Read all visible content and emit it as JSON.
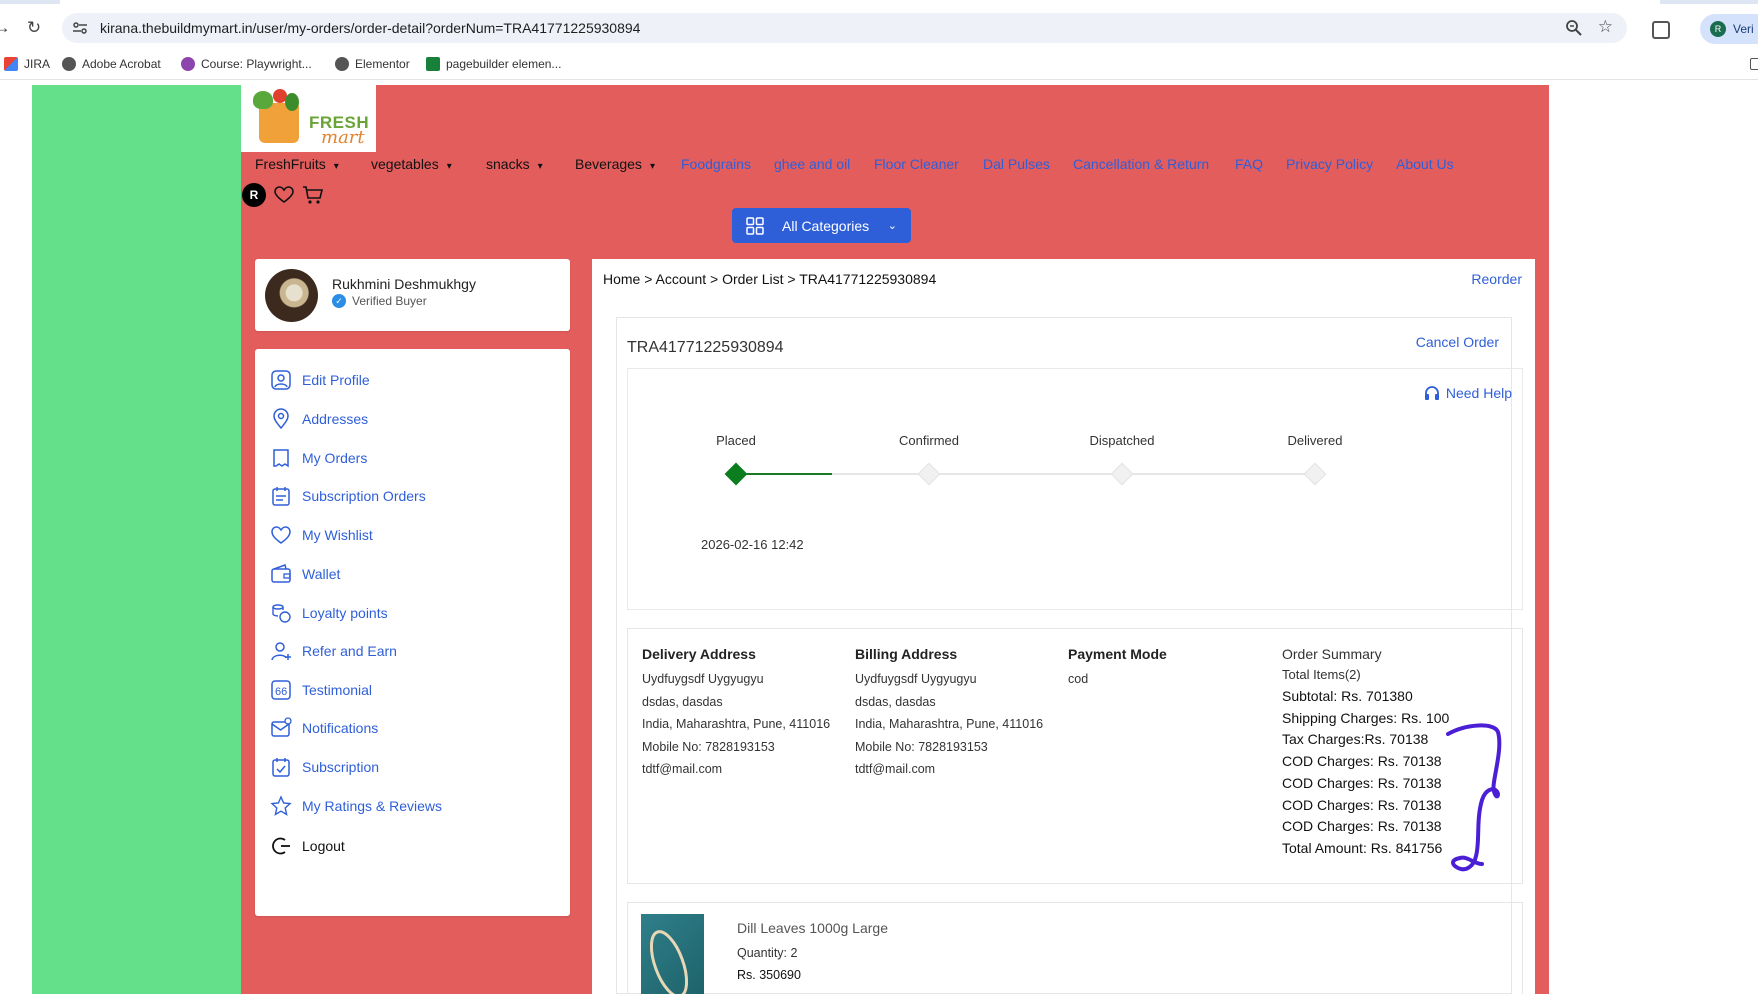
{
  "browser": {
    "url": "kirana.thebuildmymart.in/user/my-orders/order-detail?orderNum=TRA41771225930894",
    "profile_label": "Veri",
    "profile_initial": "R"
  },
  "bookmarks": [
    {
      "label": "JIRA",
      "icon": "gmail-icon",
      "color": "#d93025"
    },
    {
      "label": "Adobe Acrobat",
      "icon": "globe-icon",
      "color": "#555555"
    },
    {
      "label": "Course: Playwright...",
      "icon": "course-icon",
      "color": "#8e44ad"
    },
    {
      "label": "Elementor",
      "icon": "globe-icon",
      "color": "#555555"
    },
    {
      "label": "pagebuilder elemen...",
      "icon": "sheets-icon",
      "color": "#188038"
    }
  ],
  "logo": {
    "line1": "FRESH",
    "line2": "mart"
  },
  "nav": {
    "dropdowns": [
      "FreshFruits",
      "vegetables",
      "snacks",
      "Beverages"
    ],
    "links": [
      "Foodgrains",
      "ghee and oil",
      "Floor Cleaner",
      "Dal Pulses",
      "Cancellation & Return",
      "FAQ",
      "Privacy Policy",
      "About Us"
    ],
    "user_initial": "R",
    "all_categories": "All Categories"
  },
  "profile": {
    "name": "Rukhmini Deshmukhgy",
    "status": "Verified Buyer"
  },
  "menu": [
    {
      "label": "Edit Profile",
      "icon": "user-icon"
    },
    {
      "label": "Addresses",
      "icon": "location-icon"
    },
    {
      "label": "My Orders",
      "icon": "orders-icon"
    },
    {
      "label": "Subscription Orders",
      "icon": "subscription-orders-icon"
    },
    {
      "label": "My Wishlist",
      "icon": "heart-icon"
    },
    {
      "label": "Wallet",
      "icon": "wallet-icon"
    },
    {
      "label": "Loyalty points",
      "icon": "coins-icon"
    },
    {
      "label": "Refer and Earn",
      "icon": "refer-icon"
    },
    {
      "label": "Testimonial",
      "icon": "quote-icon"
    },
    {
      "label": "Notifications",
      "icon": "mail-icon"
    },
    {
      "label": "Subscription",
      "icon": "calendar-icon"
    },
    {
      "label": "My Ratings & Reviews",
      "icon": "star-icon"
    },
    {
      "label": "Logout",
      "icon": "logout-icon"
    }
  ],
  "breadcrumb": "Home > Account > Order List > TRA41771225930894",
  "reorder": "Reorder",
  "order": {
    "number": "TRA41771225930894",
    "cancel": "Cancel Order",
    "need_help": "Need Help",
    "steps": [
      {
        "label": "Placed",
        "done": true
      },
      {
        "label": "Confirmed",
        "done": false
      },
      {
        "label": "Dispatched",
        "done": false
      },
      {
        "label": "Delivered",
        "done": false
      }
    ],
    "placed_date": "2026-02-16 12:42",
    "progress_color": "#0b7d1e"
  },
  "delivery_address": {
    "title": "Delivery Address",
    "lines": [
      "Uydfuygsdf Uygyugyu",
      "dsdas, dasdas",
      "India, Maharashtra, Pune, 411016",
      "Mobile No: 7828193153",
      "tdtf@mail.com"
    ]
  },
  "billing_address": {
    "title": "Billing Address",
    "lines": [
      "Uydfuygsdf Uygyugyu",
      "dsdas, dasdas",
      "India, Maharashtra, Pune, 411016",
      "Mobile No: 7828193153",
      "tdtf@mail.com"
    ]
  },
  "payment": {
    "title": "Payment Mode",
    "value": "cod"
  },
  "summary": {
    "title": "Order Summary",
    "items": "Total Items(2)",
    "rows": [
      "Subtotal: Rs. 701380",
      "Shipping Charges: Rs. 100",
      "Tax Charges:Rs. 70138",
      "COD Charges: Rs. 70138",
      "COD Charges: Rs. 70138",
      "COD Charges: Rs. 70138",
      "COD Charges: Rs. 70138",
      "Total Amount: Rs. 841756"
    ]
  },
  "item": {
    "name": "Dill Leaves 1000g Large",
    "quantity": "Quantity: 2",
    "price": "Rs. 350690"
  },
  "colors": {
    "page_green": "#64e08a",
    "page_red": "#e35d5d",
    "accent_blue": "#2f5fd8",
    "scribble": "#4b1fd6"
  }
}
